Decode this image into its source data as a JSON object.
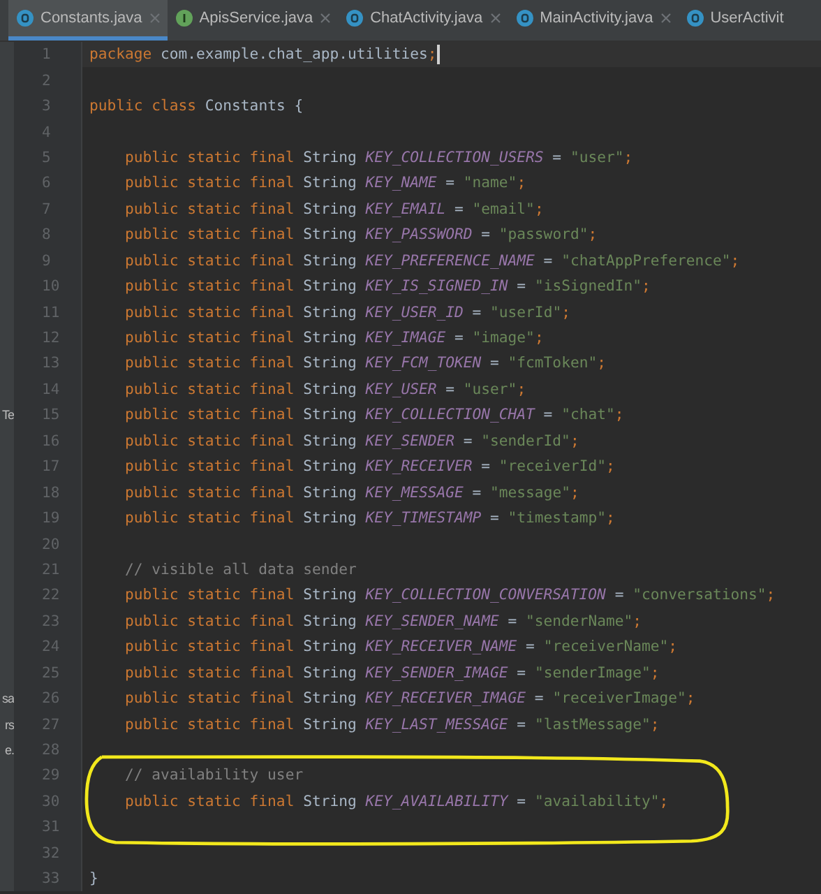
{
  "tabs": [
    {
      "label": "Constants.java",
      "kind": "class",
      "selected": true,
      "closable": true
    },
    {
      "label": "ApisService.java",
      "kind": "interface",
      "selected": false,
      "closable": true
    },
    {
      "label": "ChatActivity.java",
      "kind": "class",
      "selected": false,
      "closable": true
    },
    {
      "label": "MainActivity.java",
      "kind": "class",
      "selected": false,
      "closable": true
    },
    {
      "label": "UserActivit",
      "kind": "class",
      "selected": false,
      "closable": false
    }
  ],
  "editor": {
    "lines": [
      {
        "number": "1",
        "current": true,
        "cursor": true,
        "tokens": [
          {
            "kind": "keyword",
            "text": "package "
          },
          {
            "kind": "plain",
            "text": "com.example.chat_app.utilities"
          },
          {
            "kind": "keyword",
            "text": ";"
          }
        ]
      },
      {
        "number": "2"
      },
      {
        "number": "3",
        "tokens": [
          {
            "kind": "keyword",
            "text": "public class "
          },
          {
            "kind": "plain",
            "text": "Constants {"
          }
        ]
      },
      {
        "number": "4"
      },
      {
        "number": "5",
        "tokens": [
          {
            "kind": "keyword",
            "text": "    public static final "
          },
          {
            "kind": "plain",
            "text": "String "
          },
          {
            "kind": "constant",
            "text": "KEY_COLLECTION_USERS"
          },
          {
            "kind": "plain",
            "text": " = "
          },
          {
            "kind": "string",
            "text": "\"user\""
          },
          {
            "kind": "keyword",
            "text": ";"
          }
        ]
      },
      {
        "number": "6",
        "tokens": [
          {
            "kind": "keyword",
            "text": "    public static final "
          },
          {
            "kind": "plain",
            "text": "String "
          },
          {
            "kind": "constant",
            "text": "KEY_NAME"
          },
          {
            "kind": "plain",
            "text": " = "
          },
          {
            "kind": "string",
            "text": "\"name\""
          },
          {
            "kind": "keyword",
            "text": ";"
          }
        ]
      },
      {
        "number": "7",
        "tokens": [
          {
            "kind": "keyword",
            "text": "    public static final "
          },
          {
            "kind": "plain",
            "text": "String "
          },
          {
            "kind": "constant",
            "text": "KEY_EMAIL"
          },
          {
            "kind": "plain",
            "text": " = "
          },
          {
            "kind": "string",
            "text": "\"email\""
          },
          {
            "kind": "keyword",
            "text": ";"
          }
        ]
      },
      {
        "number": "8",
        "tokens": [
          {
            "kind": "keyword",
            "text": "    public static final "
          },
          {
            "kind": "plain",
            "text": "String "
          },
          {
            "kind": "constant",
            "text": "KEY_PASSWORD"
          },
          {
            "kind": "plain",
            "text": " = "
          },
          {
            "kind": "string",
            "text": "\"password\""
          },
          {
            "kind": "keyword",
            "text": ";"
          }
        ]
      },
      {
        "number": "9",
        "tokens": [
          {
            "kind": "keyword",
            "text": "    public static final "
          },
          {
            "kind": "plain",
            "text": "String "
          },
          {
            "kind": "constant",
            "text": "KEY_PREFERENCE_NAME"
          },
          {
            "kind": "plain",
            "text": " = "
          },
          {
            "kind": "string",
            "text": "\"chatAppPreference\""
          },
          {
            "kind": "keyword",
            "text": ";"
          }
        ]
      },
      {
        "number": "10",
        "tokens": [
          {
            "kind": "keyword",
            "text": "    public static final "
          },
          {
            "kind": "plain",
            "text": "String "
          },
          {
            "kind": "constant",
            "text": "KEY_IS_SIGNED_IN"
          },
          {
            "kind": "plain",
            "text": " = "
          },
          {
            "kind": "string",
            "text": "\"isSignedIn\""
          },
          {
            "kind": "keyword",
            "text": ";"
          }
        ]
      },
      {
        "number": "11",
        "tokens": [
          {
            "kind": "keyword",
            "text": "    public static final "
          },
          {
            "kind": "plain",
            "text": "String "
          },
          {
            "kind": "constant",
            "text": "KEY_USER_ID"
          },
          {
            "kind": "plain",
            "text": " = "
          },
          {
            "kind": "string",
            "text": "\"userId\""
          },
          {
            "kind": "keyword",
            "text": ";"
          }
        ]
      },
      {
        "number": "12",
        "tokens": [
          {
            "kind": "keyword",
            "text": "    public static final "
          },
          {
            "kind": "plain",
            "text": "String "
          },
          {
            "kind": "constant",
            "text": "KEY_IMAGE"
          },
          {
            "kind": "plain",
            "text": " = "
          },
          {
            "kind": "string",
            "text": "\"image\""
          },
          {
            "kind": "keyword",
            "text": ";"
          }
        ]
      },
      {
        "number": "13",
        "tokens": [
          {
            "kind": "keyword",
            "text": "    public static final "
          },
          {
            "kind": "plain",
            "text": "String "
          },
          {
            "kind": "constant",
            "text": "KEY_FCM_TOKEN"
          },
          {
            "kind": "plain",
            "text": " = "
          },
          {
            "kind": "string",
            "text": "\"fcmToken\""
          },
          {
            "kind": "keyword",
            "text": ";"
          }
        ]
      },
      {
        "number": "14",
        "tokens": [
          {
            "kind": "keyword",
            "text": "    public static final "
          },
          {
            "kind": "plain",
            "text": "String "
          },
          {
            "kind": "constant",
            "text": "KEY_USER"
          },
          {
            "kind": "plain",
            "text": " = "
          },
          {
            "kind": "string",
            "text": "\"user\""
          },
          {
            "kind": "keyword",
            "text": ";"
          }
        ]
      },
      {
        "number": "15",
        "side_text": "Te",
        "tokens": [
          {
            "kind": "keyword",
            "text": "    public static final "
          },
          {
            "kind": "plain",
            "text": "String "
          },
          {
            "kind": "constant",
            "text": "KEY_COLLECTION_CHAT"
          },
          {
            "kind": "plain",
            "text": " = "
          },
          {
            "kind": "string",
            "text": "\"chat\""
          },
          {
            "kind": "keyword",
            "text": ";"
          }
        ]
      },
      {
        "number": "16",
        "tokens": [
          {
            "kind": "keyword",
            "text": "    public static final "
          },
          {
            "kind": "plain",
            "text": "String "
          },
          {
            "kind": "constant",
            "text": "KEY_SENDER"
          },
          {
            "kind": "plain",
            "text": " = "
          },
          {
            "kind": "string",
            "text": "\"senderId\""
          },
          {
            "kind": "keyword",
            "text": ";"
          }
        ]
      },
      {
        "number": "17",
        "tokens": [
          {
            "kind": "keyword",
            "text": "    public static final "
          },
          {
            "kind": "plain",
            "text": "String "
          },
          {
            "kind": "constant",
            "text": "KEY_RECEIVER"
          },
          {
            "kind": "plain",
            "text": " = "
          },
          {
            "kind": "string",
            "text": "\"receiverId\""
          },
          {
            "kind": "keyword",
            "text": ";"
          }
        ]
      },
      {
        "number": "18",
        "tokens": [
          {
            "kind": "keyword",
            "text": "    public static final "
          },
          {
            "kind": "plain",
            "text": "String "
          },
          {
            "kind": "constant",
            "text": "KEY_MESSAGE"
          },
          {
            "kind": "plain",
            "text": " = "
          },
          {
            "kind": "string",
            "text": "\"message\""
          },
          {
            "kind": "keyword",
            "text": ";"
          }
        ]
      },
      {
        "number": "19",
        "tokens": [
          {
            "kind": "keyword",
            "text": "    public static final "
          },
          {
            "kind": "plain",
            "text": "String "
          },
          {
            "kind": "constant",
            "text": "KEY_TIMESTAMP"
          },
          {
            "kind": "plain",
            "text": " = "
          },
          {
            "kind": "string",
            "text": "\"timestamp\""
          },
          {
            "kind": "keyword",
            "text": ";"
          }
        ]
      },
      {
        "number": "20"
      },
      {
        "number": "21",
        "tokens": [
          {
            "kind": "comment",
            "text": "    // visible all data sender"
          }
        ]
      },
      {
        "number": "22",
        "tokens": [
          {
            "kind": "keyword",
            "text": "    public static final "
          },
          {
            "kind": "plain",
            "text": "String "
          },
          {
            "kind": "constant",
            "text": "KEY_COLLECTION_CONVERSATION"
          },
          {
            "kind": "plain",
            "text": " = "
          },
          {
            "kind": "string",
            "text": "\"conversations\""
          },
          {
            "kind": "keyword",
            "text": ";"
          }
        ]
      },
      {
        "number": "23",
        "tokens": [
          {
            "kind": "keyword",
            "text": "    public static final "
          },
          {
            "kind": "plain",
            "text": "String "
          },
          {
            "kind": "constant",
            "text": "KEY_SENDER_NAME"
          },
          {
            "kind": "plain",
            "text": " = "
          },
          {
            "kind": "string",
            "text": "\"senderName\""
          },
          {
            "kind": "keyword",
            "text": ";"
          }
        ]
      },
      {
        "number": "24",
        "tokens": [
          {
            "kind": "keyword",
            "text": "    public static final "
          },
          {
            "kind": "plain",
            "text": "String "
          },
          {
            "kind": "constant",
            "text": "KEY_RECEIVER_NAME"
          },
          {
            "kind": "plain",
            "text": " = "
          },
          {
            "kind": "string",
            "text": "\"receiverName\""
          },
          {
            "kind": "keyword",
            "text": ";"
          }
        ]
      },
      {
        "number": "25",
        "tokens": [
          {
            "kind": "keyword",
            "text": "    public static final "
          },
          {
            "kind": "plain",
            "text": "String "
          },
          {
            "kind": "constant",
            "text": "KEY_SENDER_IMAGE"
          },
          {
            "kind": "plain",
            "text": " = "
          },
          {
            "kind": "string",
            "text": "\"senderImage\""
          },
          {
            "kind": "keyword",
            "text": ";"
          }
        ]
      },
      {
        "number": "26",
        "side_text": "sa",
        "tokens": [
          {
            "kind": "keyword",
            "text": "    public static final "
          },
          {
            "kind": "plain",
            "text": "String "
          },
          {
            "kind": "constant",
            "text": "KEY_RECEIVER_IMAGE"
          },
          {
            "kind": "plain",
            "text": " = "
          },
          {
            "kind": "string",
            "text": "\"receiverImage\""
          },
          {
            "kind": "keyword",
            "text": ";"
          }
        ]
      },
      {
        "number": "27",
        "side_text": "rs",
        "tokens": [
          {
            "kind": "keyword",
            "text": "    public static final "
          },
          {
            "kind": "plain",
            "text": "String "
          },
          {
            "kind": "constant",
            "text": "KEY_LAST_MESSAGE"
          },
          {
            "kind": "plain",
            "text": " = "
          },
          {
            "kind": "string",
            "text": "\"lastMessage\""
          },
          {
            "kind": "keyword",
            "text": ";"
          }
        ]
      },
      {
        "number": "28",
        "side_text": "e."
      },
      {
        "number": "29",
        "tokens": [
          {
            "kind": "comment",
            "text": "    // availability user"
          }
        ]
      },
      {
        "number": "30",
        "tokens": [
          {
            "kind": "keyword",
            "text": "    public static final "
          },
          {
            "kind": "plain",
            "text": "String "
          },
          {
            "kind": "constant",
            "text": "KEY_AVAILABILITY"
          },
          {
            "kind": "plain",
            "text": " = "
          },
          {
            "kind": "string",
            "text": "\"availability\""
          },
          {
            "kind": "keyword",
            "text": ";"
          }
        ]
      },
      {
        "number": "31"
      },
      {
        "number": "32"
      },
      {
        "number": "33",
        "tokens": [
          {
            "kind": "plain",
            "text": "}"
          }
        ]
      }
    ]
  }
}
